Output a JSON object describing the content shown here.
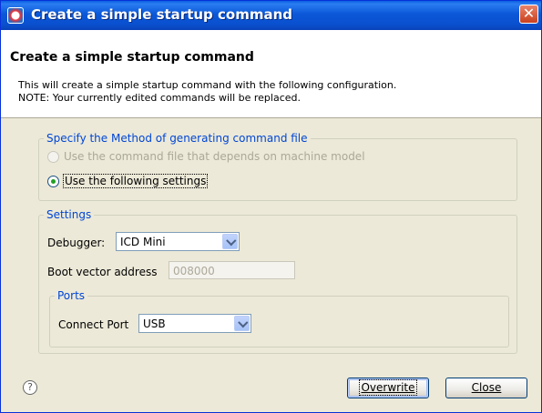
{
  "window": {
    "title": "Create a simple startup command",
    "close_glyph": "✕"
  },
  "header": {
    "heading": "Create a simple startup command",
    "description_line1": "This will create a simple startup command with the following configuration.",
    "description_line2": "NOTE: Your currently edited commands will be replaced."
  },
  "method_group": {
    "legend": "Specify the Method of generating command file",
    "option_machine_model": "Use the command file that depends on machine model",
    "option_following": "Use the following settings",
    "selected": "Use the following settings"
  },
  "settings_group": {
    "legend": "Settings",
    "debugger_label": "Debugger:",
    "debugger_value": "ICD Mini",
    "boot_vector_label": "Boot vector address",
    "boot_vector_value": "008000"
  },
  "ports_group": {
    "legend": "Ports",
    "connect_port_label": "Connect Port",
    "connect_port_value": "USB"
  },
  "footer": {
    "help_glyph": "?",
    "overwrite_label": "Overwrite",
    "close_label": "Close"
  },
  "colors": {
    "title_bar": "#0a58d8",
    "group_legend": "#0046d5",
    "dialog_background": "#ece9d8"
  }
}
